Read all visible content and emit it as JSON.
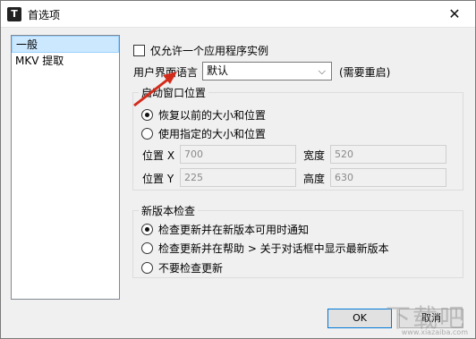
{
  "window": {
    "title": "首选项",
    "app_icon": "T",
    "close_symbol": "✕"
  },
  "sidebar": {
    "items": [
      {
        "label": "一般",
        "selected": true
      },
      {
        "label": "MKV 提取",
        "selected": false
      }
    ]
  },
  "general": {
    "single_instance_label": "仅允许一个应用程序实例",
    "ui_language_label": "用户界面语言",
    "ui_language_value": "默认",
    "restart_note": "(需要重启)"
  },
  "startup_position": {
    "group_title": "启动窗口位置",
    "options": [
      {
        "label": "恢复以前的大小和位置",
        "selected": true
      },
      {
        "label": "使用指定的大小和位置",
        "selected": false
      }
    ],
    "fields": {
      "pos_x_label": "位置 X",
      "pos_x_value": "700",
      "width_label": "宽度",
      "width_value": "520",
      "pos_y_label": "位置 Y",
      "pos_y_value": "225",
      "height_label": "高度",
      "height_value": "630"
    }
  },
  "update_check": {
    "group_title": "新版本检查",
    "options": [
      {
        "label": "检查更新并在新版本可用时通知",
        "selected": true
      },
      {
        "label": "检查更新并在帮助 > 关于对话框中显示最新版本",
        "selected": false
      },
      {
        "label": "不要检查更新",
        "selected": false
      }
    ]
  },
  "buttons": {
    "ok": "OK",
    "cancel": "取消"
  },
  "watermark": {
    "text": "下载吧",
    "sub": "www.xiazaiba.com"
  },
  "colors": {
    "accent": "#0078d7",
    "arrow": "#d42a1a",
    "selected_bg": "#cce8ff"
  }
}
